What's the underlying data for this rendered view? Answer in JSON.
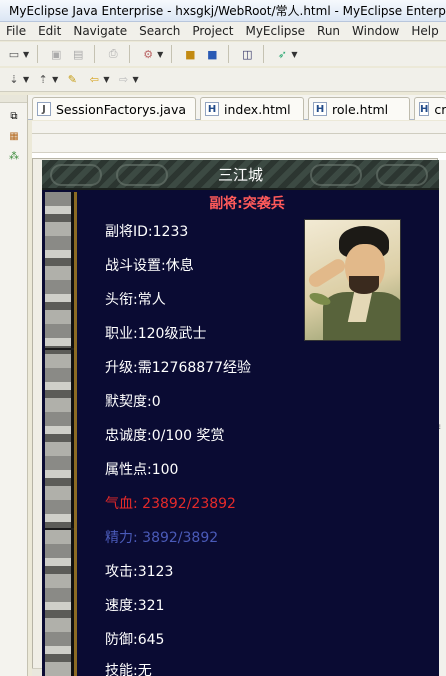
{
  "window": {
    "title": "MyEclipse Java Enterprise - hxsgkj/WebRoot/常人.html - MyEclipse Enterpr"
  },
  "menu": {
    "items": [
      "File",
      "Edit",
      "Navigate",
      "Search",
      "Project",
      "MyEclipse",
      "Run",
      "Window",
      "Help"
    ]
  },
  "tabs": [
    {
      "label": "SessionFactorys.java",
      "icon": "java-file-icon"
    },
    {
      "label": "index.html",
      "icon": "html-file-icon"
    },
    {
      "label": "role.html",
      "icon": "html-file-icon"
    },
    {
      "label": "cre",
      "icon": "html-file-icon"
    }
  ],
  "game": {
    "city": "三江城",
    "general_name": "副将:突袭兵",
    "stats": {
      "id": "副将ID:1233",
      "battle_setting": "战斗设置:休息",
      "rank_title": "头衔:常人",
      "profession": "职业:120级武士",
      "upgrade": "升级:需12768877经验",
      "tacit": "默契度:0",
      "loyalty": "忠诚度:0/100 奖赏",
      "attribute_points": "属性点:100",
      "hp": "气血: 23892/23892",
      "energy": "精力: 3892/3892",
      "attack": "攻击:3123",
      "speed": "速度:321",
      "defense": "防御:645",
      "skill": "技能:无"
    },
    "colors": {
      "background": "#0a0b33",
      "name": "#ff5a5a",
      "hp": "#e62a2a",
      "energy": "#4a5ab8"
    }
  }
}
